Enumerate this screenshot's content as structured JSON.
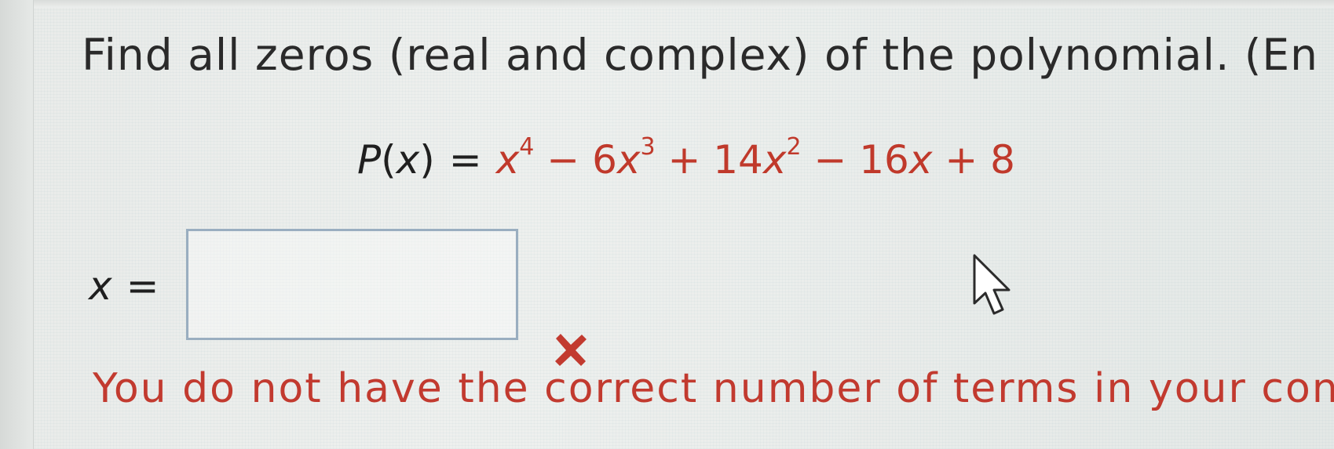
{
  "question": {
    "instruction": "Find all zeros (real and complex) of the polynomial. (En"
  },
  "equation": {
    "lhs_func": "P",
    "lhs_paren_open": "(",
    "lhs_var": "x",
    "lhs_paren_close": ")",
    "equals": "=",
    "term1_var": "x",
    "term1_exp": "4",
    "op1": " − ",
    "term2_coef": "6",
    "term2_var": "x",
    "term2_exp": "3",
    "op2": " + ",
    "term3_coef": "14",
    "term3_var": "x",
    "term3_exp": "2",
    "op3": " − ",
    "term4_coef": "16",
    "term4_var": "x",
    "op4": " + ",
    "term5_const": "8"
  },
  "answer": {
    "label_var": "x",
    "label_equals": "=",
    "value": "",
    "placeholder": ""
  },
  "feedback": {
    "icon": "close-icon",
    "message": "You do not have the correct number of terms in your con"
  },
  "colors": {
    "error": "#c23a2f",
    "equation_terms": "#c0392b",
    "input_border": "#9aaec0",
    "text": "#2a2a2a"
  },
  "cursor": {
    "icon": "mouse-pointer-icon"
  }
}
